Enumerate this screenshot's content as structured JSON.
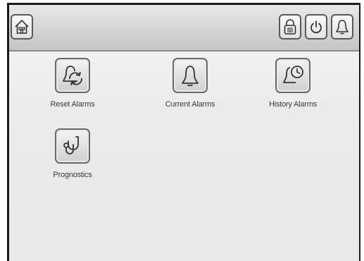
{
  "topbar": {
    "home": {
      "icon": "home-icon"
    },
    "lock": {
      "icon": "padlock-icon"
    },
    "power": {
      "icon": "power-icon"
    },
    "alarm": {
      "icon": "bell-icon"
    }
  },
  "menu": {
    "reset_alarms": {
      "label": "Reset Alarms",
      "icon": "bell-reset-icon"
    },
    "current_alarms": {
      "label": "Current Alarms",
      "icon": "bell-icon"
    },
    "history_alarms": {
      "label": "History Alarms",
      "icon": "bell-clock-icon"
    },
    "prognostics": {
      "label": "Prognostics",
      "icon": "stethoscope-icon"
    }
  }
}
